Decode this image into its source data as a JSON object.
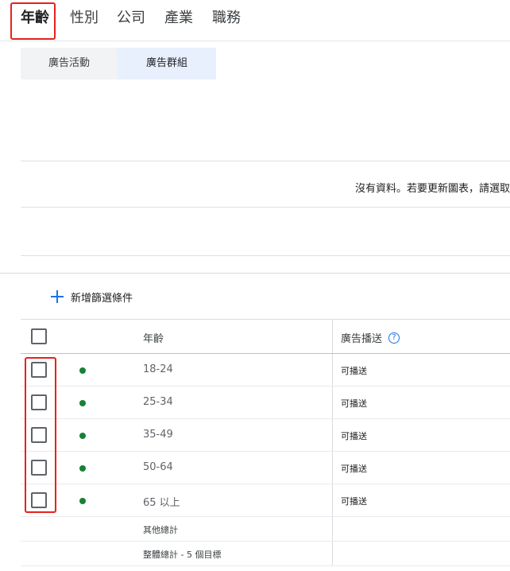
{
  "tabs": [
    {
      "label": "年齡",
      "active": true
    },
    {
      "label": "性別",
      "active": false
    },
    {
      "label": "公司",
      "active": false
    },
    {
      "label": "產業",
      "active": false
    },
    {
      "label": "職務",
      "active": false
    }
  ],
  "subtabs": {
    "campaigns": "廣告活動",
    "ad_groups": "廣告群組",
    "selected": "ad_groups"
  },
  "chart": {
    "no_data_message": "沒有資料。若要更新圖表，請選取"
  },
  "filter": {
    "add_label": "新增篩選條件"
  },
  "table": {
    "headers": {
      "age": "年齡",
      "delivery": "廣告播送"
    },
    "rows": [
      {
        "age": "18-24",
        "delivery": "可播送"
      },
      {
        "age": "25-34",
        "delivery": "可播送"
      },
      {
        "age": "35-49",
        "delivery": "可播送"
      },
      {
        "age": "50-64",
        "delivery": "可播送"
      },
      {
        "age": "65 以上",
        "delivery": "可播送"
      }
    ],
    "totals": {
      "other": "其他總計",
      "overall": "整體總計 - 5 個目標"
    }
  },
  "colors": {
    "highlight": "#e8211b",
    "accent": "#1a73e8",
    "status_enabled": "#188038"
  }
}
